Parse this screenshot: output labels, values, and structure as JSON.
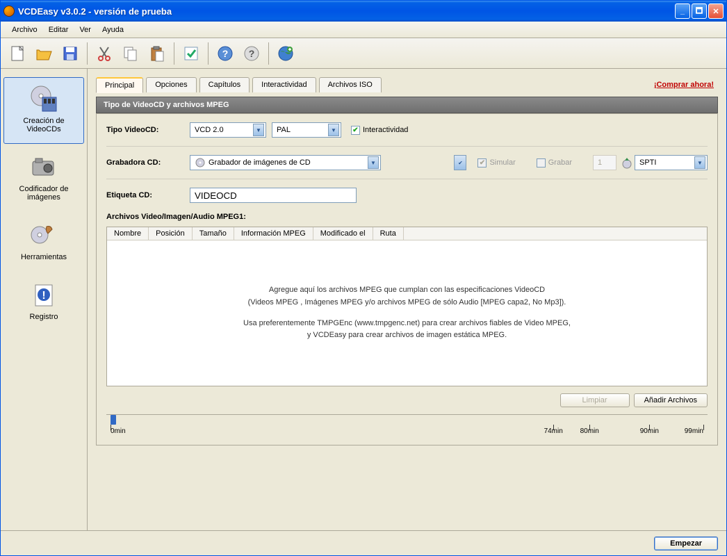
{
  "titlebar": "VCDEasy v3.0.2 - versión de prueba",
  "menu": {
    "file": "Archivo",
    "edit": "Editar",
    "view": "Ver",
    "help": "Ayuda"
  },
  "sidebar": {
    "items": [
      {
        "label": "Creación de VideoCDs"
      },
      {
        "label": "Codificador de imágenes"
      },
      {
        "label": "Herramientas"
      },
      {
        "label": "Registro"
      }
    ]
  },
  "tabs": {
    "items": [
      {
        "label": "Principal"
      },
      {
        "label": "Opciones"
      },
      {
        "label": "Capítulos"
      },
      {
        "label": "Interactividad"
      },
      {
        "label": "Archivos ISO"
      }
    ]
  },
  "buy_link": "¡Comprar ahora!",
  "section": {
    "header": "Tipo de VideoCD y archivos MPEG",
    "type_label": "Tipo VideoCD:",
    "type_value": "VCD 2.0",
    "format_value": "PAL",
    "interactividad": "Interactividad",
    "recorder_label": "Grabadora CD:",
    "recorder_value": "Grabador de imágenes de CD",
    "simulate": "Simular",
    "record": "Grabar",
    "copies": "1",
    "interface": "SPTI",
    "etiqueta_label": "Etiqueta CD:",
    "etiqueta_value": "VIDEOCD"
  },
  "files": {
    "title": "Archivos Video/Imagen/Audio MPEG1:",
    "columns": [
      "Nombre",
      "Posición",
      "Tamaño",
      "Información MPEG",
      "Modificado el",
      "Ruta"
    ],
    "empty1": "Agregue aquí los archivos MPEG que cumplan con las especificaciones VideoCD",
    "empty2": "(Videos MPEG , Imágenes MPEG y/o archivos MPEG de sólo Audio [MPEG capa2, No Mp3]).",
    "empty3": "Usa preferentemente TMPGEnc (www.tmpgenc.net) para crear archivos fiables de Video MPEG,",
    "empty4": "y VCDEasy para crear archivos de imagen estática MPEG."
  },
  "buttons": {
    "clear": "Limpiar",
    "add": "Añadir Archivos",
    "start": "Empezar"
  },
  "timeline": {
    "ticks": [
      {
        "label": "0min",
        "pct": 0
      },
      {
        "label": "74min",
        "pct": 74.7
      },
      {
        "label": "80min",
        "pct": 80.8
      },
      {
        "label": "90min",
        "pct": 90.9
      },
      {
        "label": "99min",
        "pct": 100
      }
    ]
  }
}
